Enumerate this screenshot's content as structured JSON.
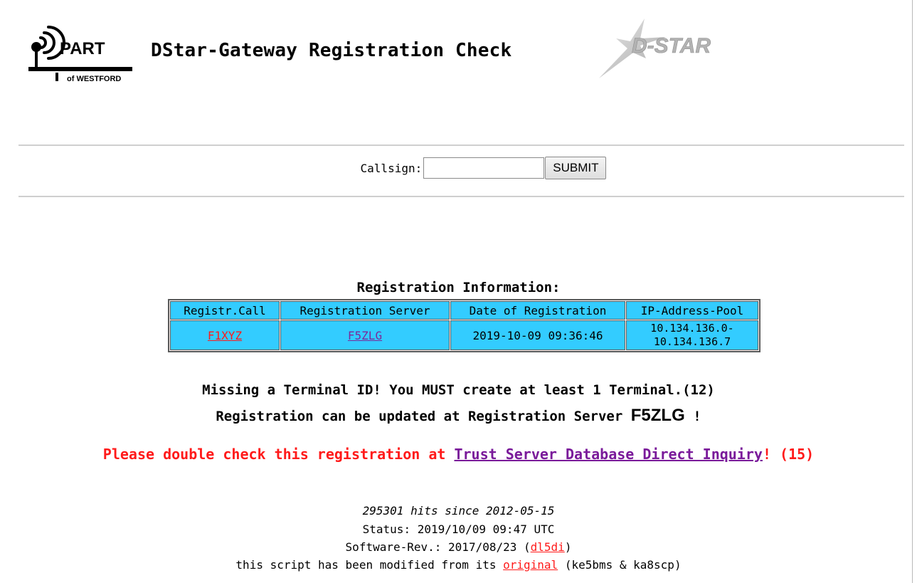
{
  "header": {
    "part_logo_text": "PART",
    "part_logo_subtext": "of WESTFORD",
    "title": "DStar-Gateway Registration Check",
    "dstar_logo_text": "D-STAR"
  },
  "form": {
    "callsign_label": "Callsign:",
    "callsign_value": "",
    "submit_label": "SUBMIT"
  },
  "registration": {
    "caption": "Registration Information:",
    "columns": [
      "Registr.Call",
      "Registration Server",
      "Date of Registration",
      "IP-Address-Pool"
    ],
    "row": {
      "call": "F1XYZ",
      "server": "F5ZLG",
      "date": "2019-10-09 09:36:46",
      "ip_line1": "10.134.136.0-",
      "ip_line2": "10.134.136.7"
    },
    "cell_color": "#33ccff"
  },
  "messages": {
    "missing_terminal": "Missing a Terminal ID! You MUST create at least 1 Terminal.(12)",
    "update_prefix": "Registration can be updated at Registration Server",
    "update_server": "F5ZLG",
    "update_suffix": "!",
    "check_prefix": "Please double check this registration at",
    "check_link": "Trust Server Database Direct Inquiry",
    "check_suffix": "! (15)"
  },
  "footer": {
    "hits": "295301 hits since 2012-05-15",
    "status": "Status: 2019/10/09 09:47 UTC",
    "software_prefix": "Software-Rev.: 2017/08/23 (",
    "software_link": "dl5di",
    "software_suffix": ")",
    "modified_prefix": "this script has been modified from its",
    "modified_link": "original",
    "modified_suffix": "(ke5bms & ka8scp)"
  },
  "colors": {
    "warning_red": "#ff1a1a",
    "link_purple": "#7a2a9a"
  }
}
